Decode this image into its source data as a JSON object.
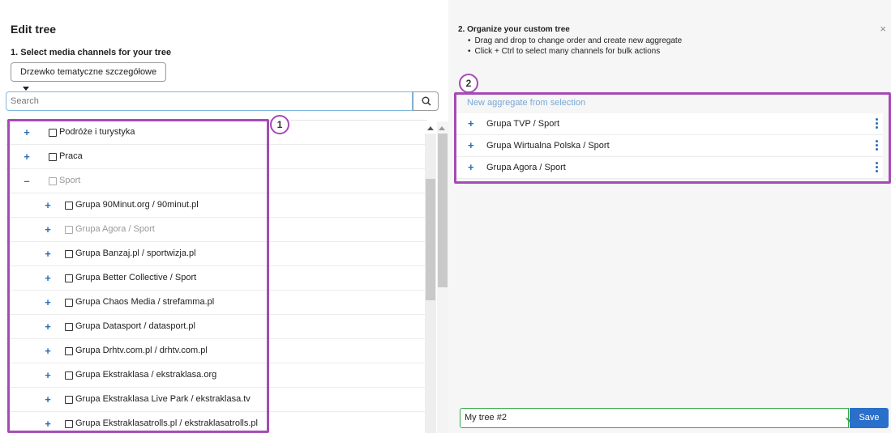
{
  "left": {
    "title": "Edit tree",
    "step_label": "1. Select media channels for your tree",
    "dropdown_value": "Drzewko tematyczne szczegółowe",
    "search_placeholder": "Search",
    "tree_items": [
      {
        "toggle": "+",
        "label": "Podróże i turystyka"
      },
      {
        "toggle": "+",
        "label": "Praca"
      },
      {
        "toggle": "–",
        "label": "Sport"
      },
      {
        "toggle": "+",
        "label": "Grupa 90Minut.org / 90minut.pl"
      },
      {
        "toggle": "+",
        "label": "Grupa Agora / Sport"
      },
      {
        "toggle": "+",
        "label": "Grupa Banzaj.pl / sportwizja.pl"
      },
      {
        "toggle": "+",
        "label": "Grupa Better Collective / Sport"
      },
      {
        "toggle": "+",
        "label": "Grupa Chaos Media / strefamma.pl"
      },
      {
        "toggle": "+",
        "label": "Grupa Datasport / datasport.pl"
      },
      {
        "toggle": "+",
        "label": "Grupa Drhtv.com.pl / drhtv.com.pl"
      },
      {
        "toggle": "+",
        "label": "Grupa Ekstraklasa / ekstraklasa.org"
      },
      {
        "toggle": "+",
        "label": "Grupa Ekstraklasa Live Park / ekstraklasa.tv"
      },
      {
        "toggle": "+",
        "label": "Grupa Ekstraklasatrolls.pl / ekstraklasatrolls.pl"
      }
    ],
    "badge": "1"
  },
  "right": {
    "step_label": "2. Organize your custom tree",
    "bullets": [
      "Drag and drop to change order and create new aggregate",
      "Click + Ctrl to select many channels for bulk actions"
    ],
    "close": "×",
    "badge": "2",
    "aggregate_link": "New aggregate from selection",
    "items": [
      {
        "toggle": "+",
        "label": "Grupa TVP / Sport"
      },
      {
        "toggle": "+",
        "label": "Grupa Wirtualna Polska / Sport"
      },
      {
        "toggle": "+",
        "label": "Grupa Agora / Sport"
      }
    ],
    "tree_name": "My tree #2",
    "save_label": "Save"
  },
  "colors": {
    "accent": "#2a6fc9",
    "highlight": "#a54ab5",
    "valid": "#35a846"
  }
}
